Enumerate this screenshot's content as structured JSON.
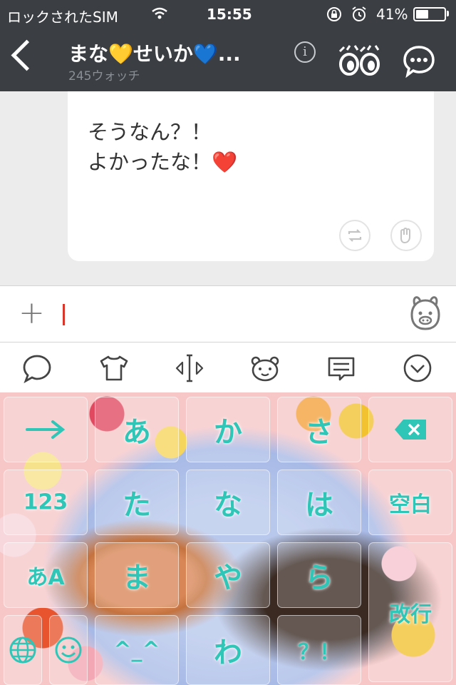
{
  "status_bar": {
    "carrier": "ロックされたSIM",
    "time": "15:55",
    "battery_percent": "41%",
    "battery_level": 0.41
  },
  "header": {
    "title": "まな💛せいか💙...",
    "subtitle": "245ウォッチ",
    "info_icon": "i"
  },
  "message": {
    "lines": [
      "そうなん？！",
      "よかったな！❤️"
    ]
  },
  "input": {
    "value": "",
    "plus_label": "+"
  },
  "toolbar": {
    "icons": [
      "speech-bubble-icon",
      "tshirt-icon",
      "cursor-move-icon",
      "bear-face-icon",
      "message-box-icon",
      "chevron-down-circle-icon"
    ]
  },
  "keyboard": {
    "keys": {
      "next": "",
      "a": "あ",
      "ka": "か",
      "sa": "さ",
      "delete": "",
      "num": "123",
      "ta": "た",
      "na": "な",
      "ha": "は",
      "space": "空白",
      "mode": "あA",
      "ma": "ま",
      "ya": "や",
      "ra": "ら",
      "enter": "改行",
      "globe": "",
      "emoji": "",
      "kaomoji": "^_^",
      "wa": "わ",
      "punct": "？！"
    }
  },
  "colors": {
    "header_bg": "#3b3f44",
    "key_text": "#2fc6b8",
    "caret": "#d9362b"
  }
}
